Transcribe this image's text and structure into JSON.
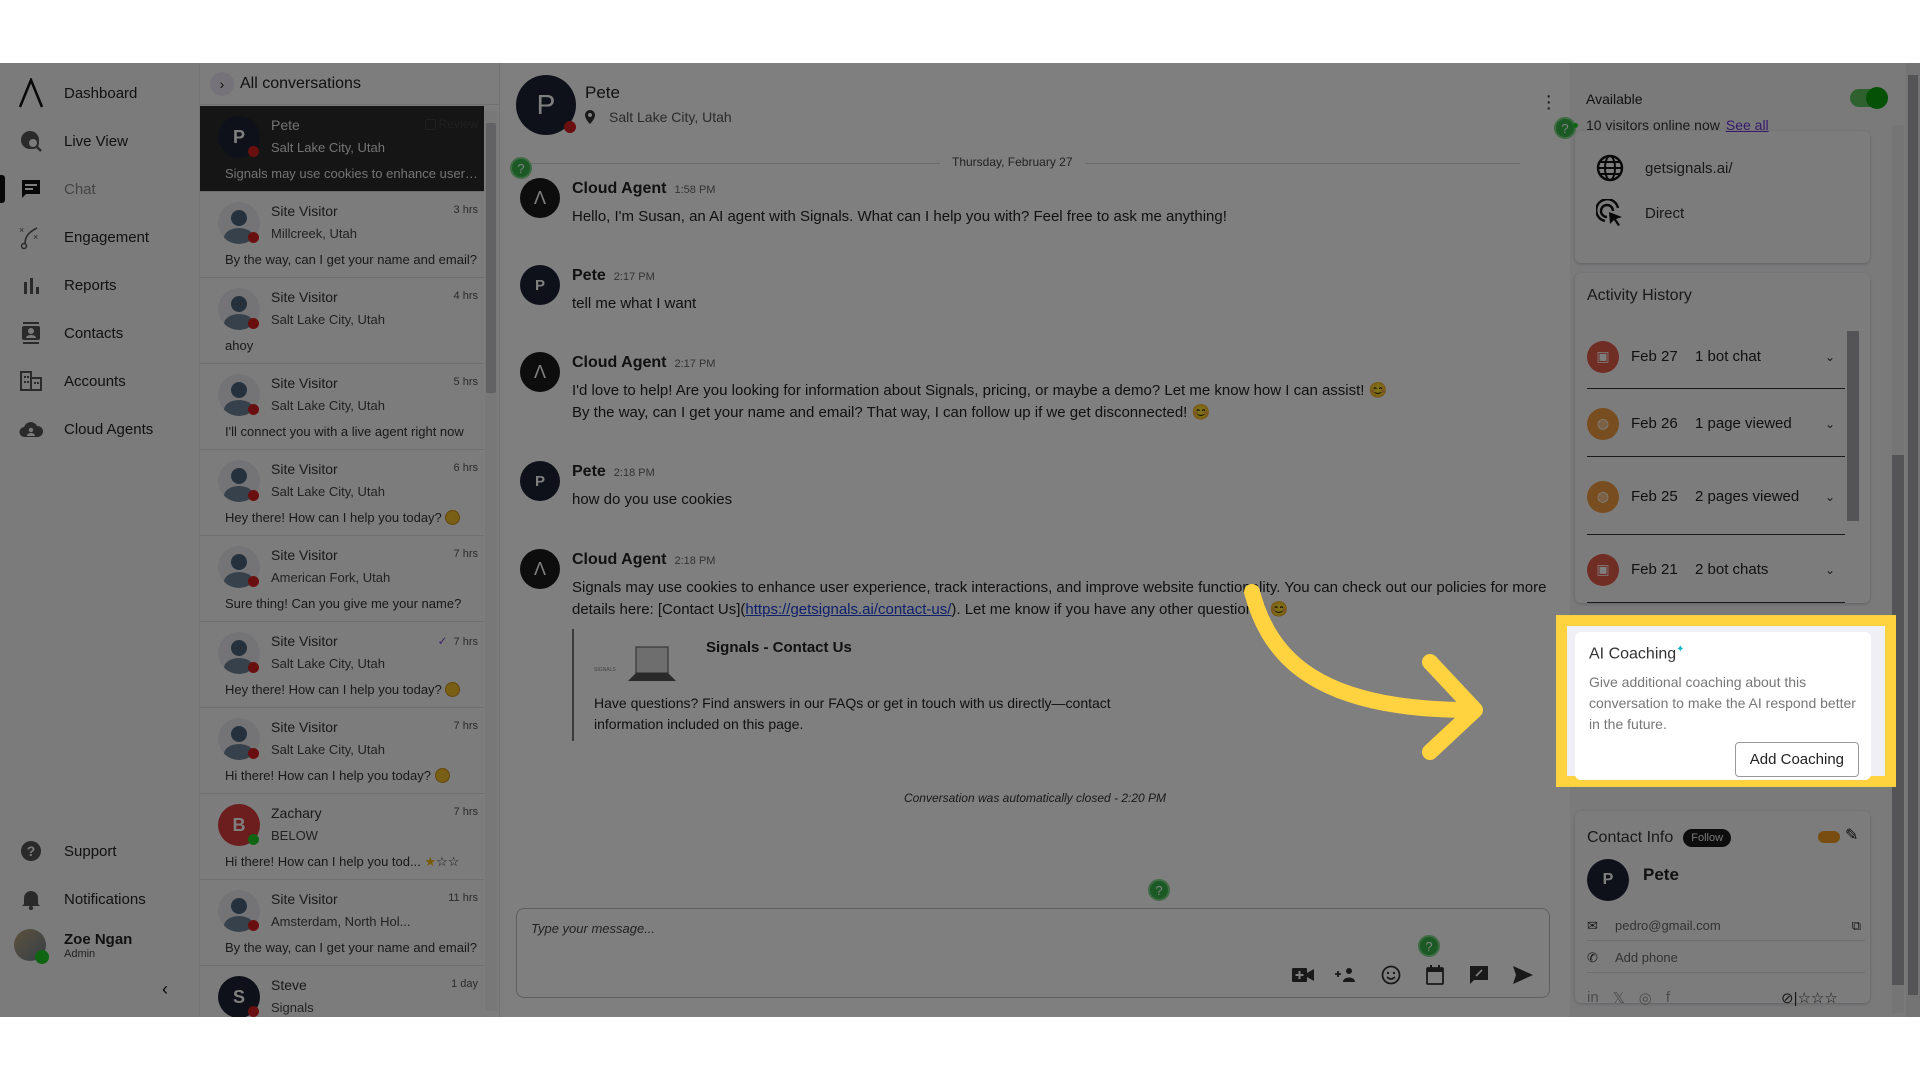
{
  "sidebar": {
    "items": [
      {
        "label": "Dashboard",
        "icon": "logo-icon"
      },
      {
        "label": "Live View",
        "icon": "live-view-icon"
      },
      {
        "label": "Chat",
        "icon": "chat-icon"
      },
      {
        "label": "Engagement",
        "icon": "engagement-icon"
      },
      {
        "label": "Reports",
        "icon": "reports-icon"
      },
      {
        "label": "Contacts",
        "icon": "contacts-icon"
      },
      {
        "label": "Accounts",
        "icon": "accounts-icon"
      },
      {
        "label": "Cloud Agents",
        "icon": "cloud-agents-icon"
      }
    ],
    "bottom": [
      {
        "label": "Support",
        "icon": "help-icon"
      },
      {
        "label": "Notifications",
        "icon": "bell-icon"
      }
    ],
    "user": {
      "name": "Zoe Ngan",
      "role": "Admin"
    },
    "collapse": "‹"
  },
  "conversations": {
    "header": "All conversations",
    "review_label": "Review",
    "items": [
      {
        "name": "Pete",
        "location": "Salt Lake City, Utah",
        "time": "",
        "preview": "Signals may use cookies to enhance user experience",
        "avatar": "P"
      },
      {
        "name": "Site Visitor",
        "location": "Millcreek, Utah",
        "time": "3 hrs",
        "preview": "By the way, can I get your name and email?"
      },
      {
        "name": "Site Visitor",
        "location": "Salt Lake City, Utah",
        "time": "4 hrs",
        "preview": "ahoy"
      },
      {
        "name": "Site Visitor",
        "location": "Salt Lake City, Utah",
        "time": "5 hrs",
        "preview": "I'll connect you with a live agent right now"
      },
      {
        "name": "Site Visitor",
        "location": "Salt Lake City, Utah",
        "time": "6 hrs",
        "preview": "Hey there! How can I help you today?"
      },
      {
        "name": "Site Visitor",
        "location": "American Fork, Utah",
        "time": "7 hrs",
        "preview": "Sure thing! Can you give me your name?"
      },
      {
        "name": "Site Visitor",
        "location": "Salt Lake City, Utah",
        "time": "7 hrs",
        "preview": "Hey there! How can I help you today?"
      },
      {
        "name": "Site Visitor",
        "location": "Salt Lake City, Utah",
        "time": "7 hrs",
        "preview": "Hi there! How can I help you today?"
      },
      {
        "name": "Zachary",
        "location": "BELOW",
        "time": "7 hrs",
        "preview": "Hi there! How can I help you tod...",
        "avatar": "B"
      },
      {
        "name": "Site Visitor",
        "location": "Amsterdam, North Hol...",
        "time": "11 hrs",
        "preview": "By the way, can I get your name and email?"
      },
      {
        "name": "Steve",
        "location": "Signals",
        "time": "1 day",
        "preview": "",
        "avatar": "S"
      }
    ]
  },
  "chat": {
    "contact_name": "Pete",
    "contact_location": "Salt Lake City, Utah",
    "avatar": "P",
    "date_separator": "Thursday, February 27",
    "messages": [
      {
        "author": "Cloud Agent",
        "time": "1:58 PM",
        "text": "Hello, I'm Susan, an AI agent with Signals. What can I help you with? Feel free to ask me anything!"
      },
      {
        "author": "Pete",
        "time": "2:17 PM",
        "text": "tell me what I want"
      },
      {
        "author": "Cloud Agent",
        "time": "2:17 PM",
        "text": "I'd love to help! Are you looking for information about Signals, pricing, or maybe a demo? Let me know how I can assist! 😊",
        "text2": "By the way, can I get your name and email? That way, I can follow up if we get disconnected! 😊"
      },
      {
        "author": "Pete",
        "time": "2:18 PM",
        "text": "how do you use cookies"
      },
      {
        "author": "Cloud Agent",
        "time": "2:18 PM",
        "text_before": "Signals may use cookies to enhance user experience, track interactions, and improve website functionality. You can check out our policies for more details here: [Contact Us](",
        "link": "https://getsignals.ai/contact-us/",
        "text_after": "). Let me know if you have any other questions! 😊"
      }
    ],
    "link_card": {
      "title": "Signals - Contact Us",
      "description": "Have questions? Find answers in our FAQs or get in touch with us directly—contact information included on this page."
    },
    "closed_note": "Conversation was automatically closed - 2:20 PM",
    "composer_placeholder": "Type your message..."
  },
  "right_panel": {
    "availability_label": "Available",
    "available": true,
    "visitors_online": "10 visitors online now",
    "see_all": "See all",
    "source": {
      "url": "getsignals.ai/",
      "referrer": "Direct"
    },
    "activity": {
      "title": "Activity History",
      "items": [
        {
          "date": "Feb 27",
          "text": "1 bot chat",
          "type": "bot"
        },
        {
          "date": "Feb 26",
          "text": "1 page viewed",
          "type": "web"
        },
        {
          "date": "Feb 25",
          "text": "2 pages viewed",
          "type": "web"
        },
        {
          "date": "Feb 21",
          "text": "2 bot chats",
          "type": "bot"
        }
      ]
    },
    "coaching": {
      "title": "AI Coaching",
      "description": "Give additional coaching about this conversation to make the AI respond better in the future.",
      "button": "Add Coaching"
    },
    "contact": {
      "title": "Contact Info",
      "follow": "Follow",
      "name": "Pete",
      "avatar": "P",
      "email": "pedro@gmail.com",
      "phone_placeholder": "Add phone"
    }
  },
  "colors": {
    "highlight": "#ffd23f",
    "link": "#1c3fd6",
    "see_all": "#6a35d9",
    "toggle_on": "#0aa30a"
  }
}
